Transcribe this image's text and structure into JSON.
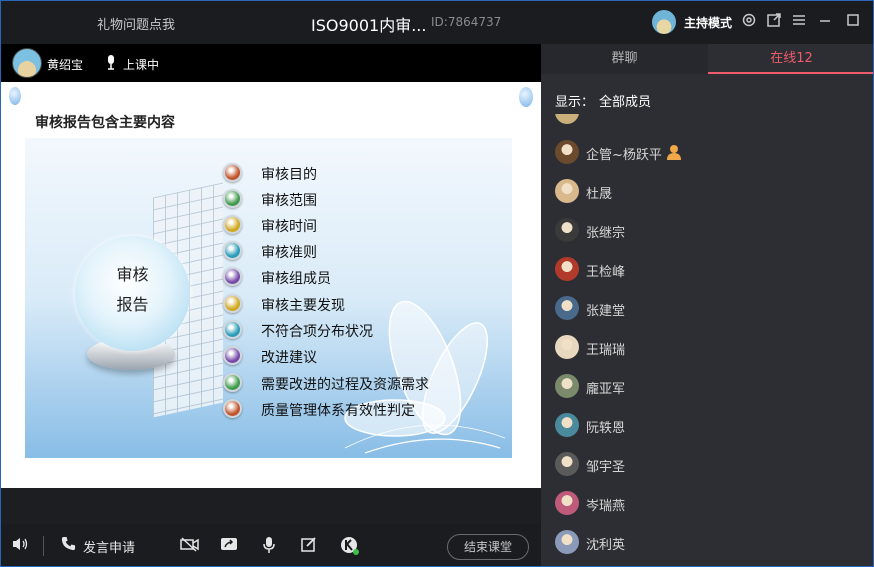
{
  "titlebar": {
    "hint": "礼物问题点我",
    "title": "ISO9001内审...",
    "room_id": "ID:7864737",
    "host_mode_label": "主持模式",
    "icons": [
      "settings-icon",
      "popout-icon",
      "menu-icon",
      "minimize-icon",
      "maximize-icon"
    ]
  },
  "presenter": {
    "name": "黄绍宝",
    "status": "上课中"
  },
  "slide": {
    "title": "审核报告包含主要内容",
    "sphere_line1": "审核",
    "sphere_line2": "报告",
    "topics": [
      {
        "label": "审核目的",
        "color": "#c0532a"
      },
      {
        "label": "审核范围",
        "color": "#3f9a4a"
      },
      {
        "label": "审核时间",
        "color": "#d0a81c"
      },
      {
        "label": "审核准则",
        "color": "#2a9cb7"
      },
      {
        "label": "审核组成员",
        "color": "#7649a8"
      },
      {
        "label": "审核主要发现",
        "color": "#d0a81c"
      },
      {
        "label": "不符合项分布状况",
        "color": "#2a9cb7"
      },
      {
        "label": "改进建议",
        "color": "#7649a8"
      },
      {
        "label": "需要改进的过程及资源需求",
        "color": "#3f9a4a"
      },
      {
        "label": "质量管理体系有效性判定",
        "color": "#c0532a"
      }
    ]
  },
  "toolbar": {
    "speak_request": "发言申请",
    "end_class": "结束课堂"
  },
  "sidebar": {
    "tab_chat": "群聊",
    "tab_online": "在线12",
    "filter_label": "显示：",
    "filter_value": "全部成员",
    "members": [
      {
        "name": "企管~杨跃平",
        "avatar_color": "#6b4a2e",
        "badge": true
      },
      {
        "name": "杜晟",
        "avatar_color": "#d9b98c",
        "badge": false
      },
      {
        "name": "张继宗",
        "avatar_color": "#3a3a3a",
        "badge": false
      },
      {
        "name": "王检峰",
        "avatar_color": "#b23a2a",
        "badge": false
      },
      {
        "name": "张建堂",
        "avatar_color": "#4a6a8c",
        "badge": false
      },
      {
        "name": "王瑞瑞",
        "avatar_color": "#e8d8c0",
        "badge": false
      },
      {
        "name": "龐亚军",
        "avatar_color": "#7a8a6a",
        "badge": false
      },
      {
        "name": "阮轶恩",
        "avatar_color": "#4a8a9c",
        "badge": false
      },
      {
        "name": "邹宇圣",
        "avatar_color": "#5a5a5a",
        "badge": false
      },
      {
        "name": "岑瑞燕",
        "avatar_color": "#c05a7a",
        "badge": false
      },
      {
        "name": "沈利英",
        "avatar_color": "#8a9ab8",
        "badge": false
      }
    ]
  }
}
